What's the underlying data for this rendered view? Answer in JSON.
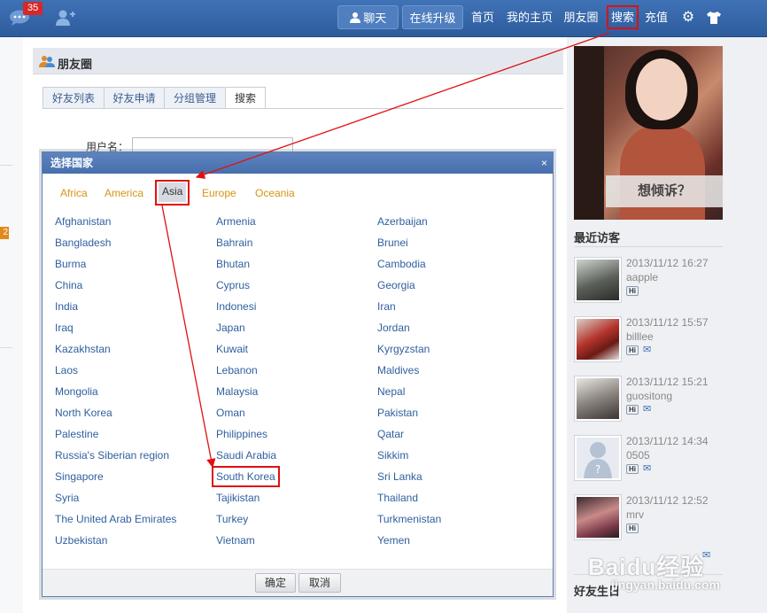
{
  "topbar": {
    "message_badge": "35",
    "chat": "聊天",
    "upgrade": "在线升级",
    "links": [
      "首页",
      "我的主页",
      "朋友圈",
      "搜索",
      "充值"
    ]
  },
  "page": {
    "section_title": "朋友圈",
    "tabs": [
      "好友列表",
      "好友申请",
      "分组管理",
      "搜索"
    ],
    "username_label": "用户名：",
    "left_badge": "2"
  },
  "dialog": {
    "title": "选择国家",
    "close": "×",
    "regions": [
      "Africa",
      "America",
      "Asia",
      "Europe",
      "Oceania"
    ],
    "selected_region": "Asia",
    "countries": [
      [
        "Afghanistan",
        "Armenia",
        "Azerbaijan"
      ],
      [
        "Bangladesh",
        "Bahrain",
        "Brunei"
      ],
      [
        "Burma",
        "Bhutan",
        "Cambodia"
      ],
      [
        "China",
        "Cyprus",
        "Georgia"
      ],
      [
        "India",
        "Indonesi",
        "Iran"
      ],
      [
        "Iraq",
        "Japan",
        "Jordan"
      ],
      [
        "Kazakhstan",
        "Kuwait",
        "Kyrgyzstan"
      ],
      [
        "Laos",
        "Lebanon",
        "Maldives"
      ],
      [
        "Mongolia",
        "Malaysia",
        "Nepal"
      ],
      [
        "North Korea",
        "Oman",
        "Pakistan"
      ],
      [
        "Palestine",
        "Philippines",
        "Qatar"
      ],
      [
        "Russia's Siberian region",
        "Saudi Arabia",
        "Sikkim"
      ],
      [
        "Singapore",
        "South Korea",
        "Sri Lanka"
      ],
      [
        "Syria",
        "Tajikistan",
        "Thailand"
      ],
      [
        "The United Arab Emirates",
        "Turkey",
        "Turkmenistan"
      ],
      [
        "Uzbekistan",
        "Vietnam",
        "Yemen"
      ]
    ],
    "highlighted_country": "South Korea",
    "ok": "确定",
    "cancel": "取消"
  },
  "sidebar": {
    "photo_cta": "想倾诉？",
    "visitors_title": "最近访客",
    "visitors": [
      {
        "time": "2013/11/12 16:27",
        "name": "aapple"
      },
      {
        "time": "2013/11/12 15:57",
        "name": "billlee"
      },
      {
        "time": "2013/11/12 15:21",
        "name": "guositong"
      },
      {
        "time": "2013/11/12 14:34",
        "name": "0505"
      },
      {
        "time": "2013/11/12 12:52",
        "name": "mrv"
      }
    ],
    "hi_label": "Hi",
    "friends_title": "好友生日"
  },
  "watermark": {
    "logo": "Baidu经验",
    "url": "jingyan.baidu.com"
  },
  "colors": {
    "topbar": "#2d5c9c",
    "link": "#2f5f9e",
    "region": "#d49512",
    "highlight": "#e01010"
  }
}
